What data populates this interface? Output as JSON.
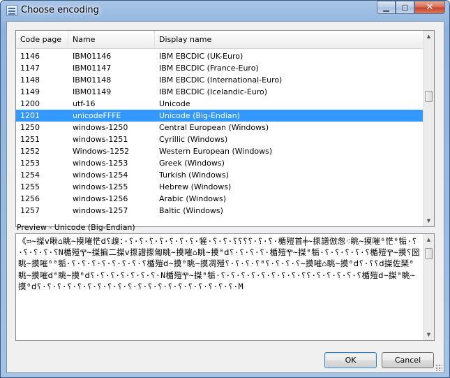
{
  "window": {
    "title": "Choose encoding"
  },
  "list": {
    "columns": [
      "Code page",
      "Name",
      "Display name"
    ],
    "rows": [
      {
        "code": "1146",
        "name": "IBM01146",
        "display": "IBM EBCDIC (UK-Euro)"
      },
      {
        "code": "1147",
        "name": "IBM01147",
        "display": "IBM EBCDIC (France-Euro)"
      },
      {
        "code": "1148",
        "name": "IBM01148",
        "display": "IBM EBCDIC (International-Euro)"
      },
      {
        "code": "1149",
        "name": "IBM01149",
        "display": "IBM EBCDIC (Icelandic-Euro)"
      },
      {
        "code": "1200",
        "name": "utf-16",
        "display": "Unicode"
      },
      {
        "code": "1201",
        "name": "unicodeFFFE",
        "display": "Unicode (Big-Endian)"
      },
      {
        "code": "1250",
        "name": "windows-1250",
        "display": "Central European (Windows)"
      },
      {
        "code": "1251",
        "name": "windows-1251",
        "display": "Cyrillic (Windows)"
      },
      {
        "code": "1252",
        "name": "Windows-1252",
        "display": "Western European (Windows)"
      },
      {
        "code": "1253",
        "name": "windows-1253",
        "display": "Greek (Windows)"
      },
      {
        "code": "1254",
        "name": "windows-1254",
        "display": "Turkish (Windows)"
      },
      {
        "code": "1255",
        "name": "windows-1255",
        "display": "Hebrew (Windows)"
      },
      {
        "code": "1256",
        "name": "windows-1256",
        "display": "Arabic (Windows)"
      },
      {
        "code": "1257",
        "name": "windows-1257",
        "display": "Baltic (Windows)"
      }
    ],
    "selected_index": 5
  },
  "preview": {
    "label": "Preview - Unicode (Big-Endian)",
    "text": "《≕∼搩ⅴ瞅⌂眺∼摸嗺恾ⅾ⸮㱗：·⸮·⸮·⸮·⸮·⸮·⸮·⸮·㹌·⸮·⸮·⸮⸮⸮⸮·⸮·⸮·楯㱯⾸╪∼揼譜倣怱⁖眺∼摸嗺⁶恾⁰㸸·⸮·⸮·⸮·⸮·⸮N楯㱯Ⰹ∼搩揙⼆搩ⅴ揼譜揼匍眺∼摸嗺⌂眺∼摸⁰ⅾ⸮·⸮·⸮·⸮·楯㱯Ⰹ∼搩⁰㸸·⸮·⸮·⸮·⸮·⸮楯㱯Ⰹ∼摸⸮圀眺∼摸嗺⁶⁰㸸·⸮·⸮·⸮·⸮·⸮·⸮·⸮·⸮楯㱯ⅾ∼摸⁰眺∼摸凋㱯⸮·⸮·⸮·⸮⁰⸮·⸮·⸮·⸮∼摸嗺⌂眺∼摸⁰ⅾ⸮·⸮⸮ⅾ搩佐琹⁰眺∼摸嗺ⅾ⁰眺∼摸⁰ⅾ⸮·⸮·⸮·⸮·⸮·⸮·⸮·N楯㱯Ⰹ∼搩⁰㸸·⸮·⸮·⸮·⸮·⸮·⸮·⸮·⸮·⸮⸮·⸮·⸮·⸮·⸮·⸮楯㱯ⅾ∼搩⁰眺∼摸⁰ⅾ⸮·⸮·⸮·⸮·⸮·⸮·⸮·⸮·⸮·⸮·⸮·⸮·⸮·⸮·⸮·⸮·⸮·⸮·⸮·⸮·M"
  },
  "buttons": {
    "ok": "OK",
    "cancel": "Cancel"
  }
}
